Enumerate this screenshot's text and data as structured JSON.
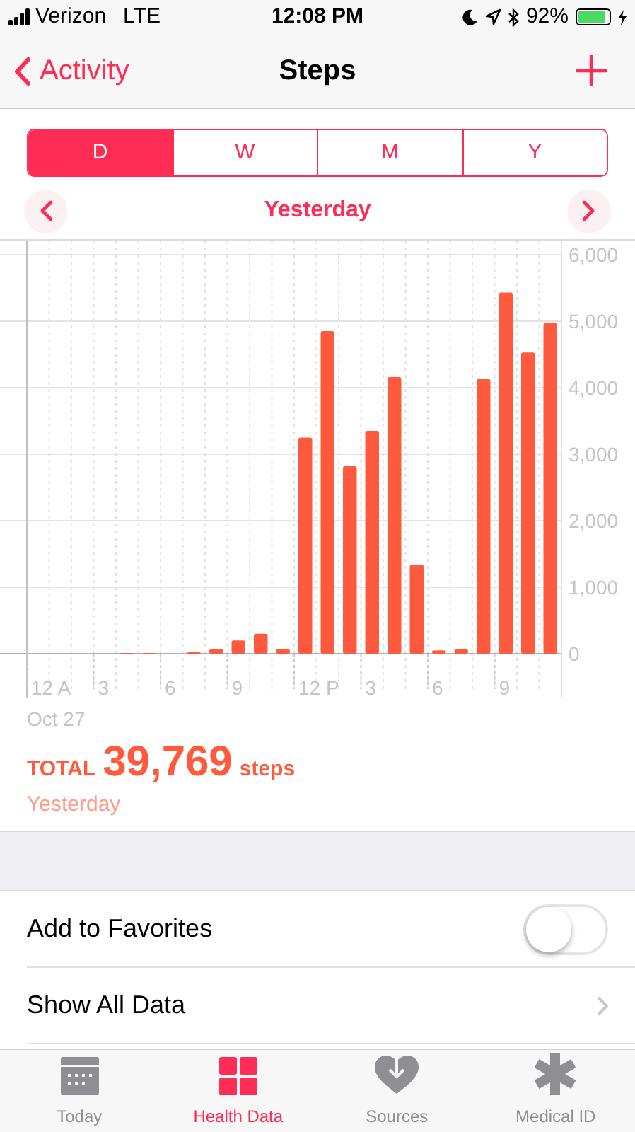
{
  "status_bar": {
    "carrier": "Verizon",
    "network": "LTE",
    "time": "12:08 PM",
    "battery": "92%"
  },
  "nav_bar": {
    "back": "Activity",
    "title": "Steps"
  },
  "segments": [
    {
      "label": "D",
      "selected": true
    },
    {
      "label": "W",
      "selected": false
    },
    {
      "label": "M",
      "selected": false
    },
    {
      "label": "Y",
      "selected": false
    }
  ],
  "date_nav": {
    "label": "Yesterday"
  },
  "chart_data": {
    "type": "bar",
    "categories": [
      "12 A",
      null,
      null,
      "3",
      null,
      null,
      "6",
      null,
      null,
      "9",
      null,
      null,
      "12 P",
      null,
      null,
      "3",
      null,
      null,
      "6",
      null,
      null,
      "9",
      null,
      null
    ],
    "grid": true,
    "series": [
      {
        "color": "#ff5a3d",
        "values": [
          0,
          0,
          0,
          0,
          10,
          10,
          0,
          20,
          70,
          200,
          300,
          70,
          3250,
          4850,
          2820,
          3350,
          4160,
          1340,
          50,
          70,
          4130,
          5430,
          4530,
          4970
        ]
      }
    ],
    "ylim": [
      0,
      6000
    ],
    "yticks": [
      {
        "value": 0,
        "label": "0"
      },
      {
        "value": 1000,
        "label": "1,000"
      },
      {
        "value": 2000,
        "label": "2,000"
      },
      {
        "value": 3000,
        "label": "3,000"
      },
      {
        "value": 4000,
        "label": "4,000"
      },
      {
        "value": 5000,
        "label": "5,000"
      },
      {
        "value": 6000,
        "label": "6,000"
      }
    ]
  },
  "chart_date": "Oct 27",
  "summary": {
    "prefix": "TOTAL",
    "value": "39,769",
    "unit": "steps",
    "period": "Yesterday"
  },
  "rows": [
    {
      "kind": "toggle",
      "label": "Add to Favorites",
      "on": false
    },
    {
      "kind": "disclosure",
      "label": "Show All Data"
    }
  ],
  "tab_bar": [
    {
      "kind": "calendar",
      "label": "Today",
      "selected": false
    },
    {
      "kind": "grid",
      "label": "Health Data",
      "selected": true
    },
    {
      "kind": "heart",
      "label": "Sources",
      "selected": false
    },
    {
      "kind": "asterisk",
      "label": "Medical ID",
      "selected": false
    }
  ]
}
